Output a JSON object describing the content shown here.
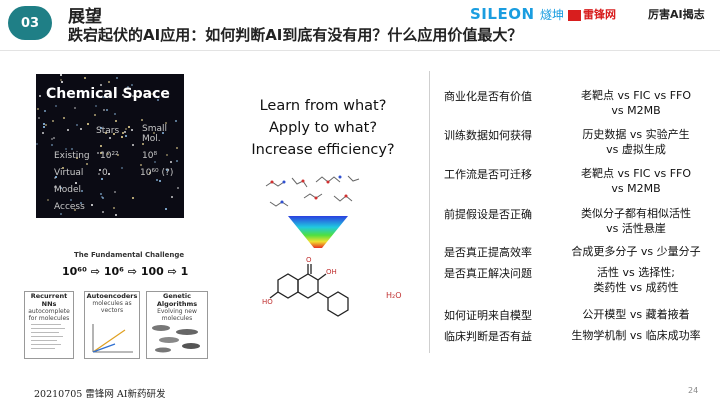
{
  "header": {
    "badge": "03",
    "title": "展望",
    "subtitle": "跌宕起伏的AI应用：如何判断AI到底有没有用？什么应用价值最大？",
    "logo_sileon": "SILEON",
    "logo_sileon_cn": "燧坤",
    "logo_leiphone": "雷锋网",
    "logo_lihai": "厉害AI揭志"
  },
  "figure": {
    "chem_title": "Chemical Space",
    "col_stars": "Stars",
    "col_small_mol": "Small Mol.",
    "row_existing": "Existing",
    "row_virtual": "Virtual",
    "row_model": "Model",
    "row_access": "Access",
    "val_existing_stars": "10²²",
    "val_existing_mol": "10⁸",
    "val_virtual_stars": "0",
    "val_virtual_mol": "10⁶⁰ (?)",
    "fund_title": "The Fundamental Challenge",
    "fund_eq": "10⁶⁰ ⇨ 10⁶ ⇨ 100 ⇨ 1",
    "rnn_title": "Recurrent NNs",
    "rnn_sub": "autocomplete for molecules",
    "ae_title": "Autoencoders",
    "ae_sub": "molecules as vectors",
    "ga_title": "Genetic Algorithms",
    "ga_sub": "Evolving new molecules"
  },
  "questions": [
    "Learn from what?",
    "Apply to what?",
    "Increase efficiency?"
  ],
  "h2o": "H₂O",
  "rows": [
    {
      "q": "商业化是否有价值",
      "a": [
        "老靶点 vs FIC vs FFO",
        "vs M2MB"
      ]
    },
    {
      "q": "训练数据如何获得",
      "a": [
        "历史数据 vs 实验产生",
        "vs 虚拟生成"
      ]
    },
    {
      "q": "工作流是否可迁移",
      "a": [
        "老靶点 vs FIC vs FFO",
        "vs M2MB"
      ]
    },
    {
      "q": "前提假设是否正确",
      "a": [
        "类似分子都有相似活性",
        "vs 活性悬崖"
      ]
    },
    {
      "q": "是否真正提高效率",
      "a": [
        "合成更多分子 vs 少量分子"
      ]
    },
    {
      "q": "是否真正解决问题",
      "a": [
        "活性 vs 选择性;",
        "类药性 vs 成药性"
      ]
    },
    {
      "q": "如何证明来自模型",
      "a": [
        "公开模型 vs 藏着掖着"
      ]
    },
    {
      "q": "临床判断是否有益",
      "a": [
        "生物学机制 vs 临床成功率"
      ]
    }
  ],
  "footer": "20210705 雷锋网 AI新药研发",
  "page_number": "24",
  "colors": {
    "badge": "#1f7f86",
    "sileon": "#1a9de0",
    "leiphone": "#d81e1e"
  }
}
